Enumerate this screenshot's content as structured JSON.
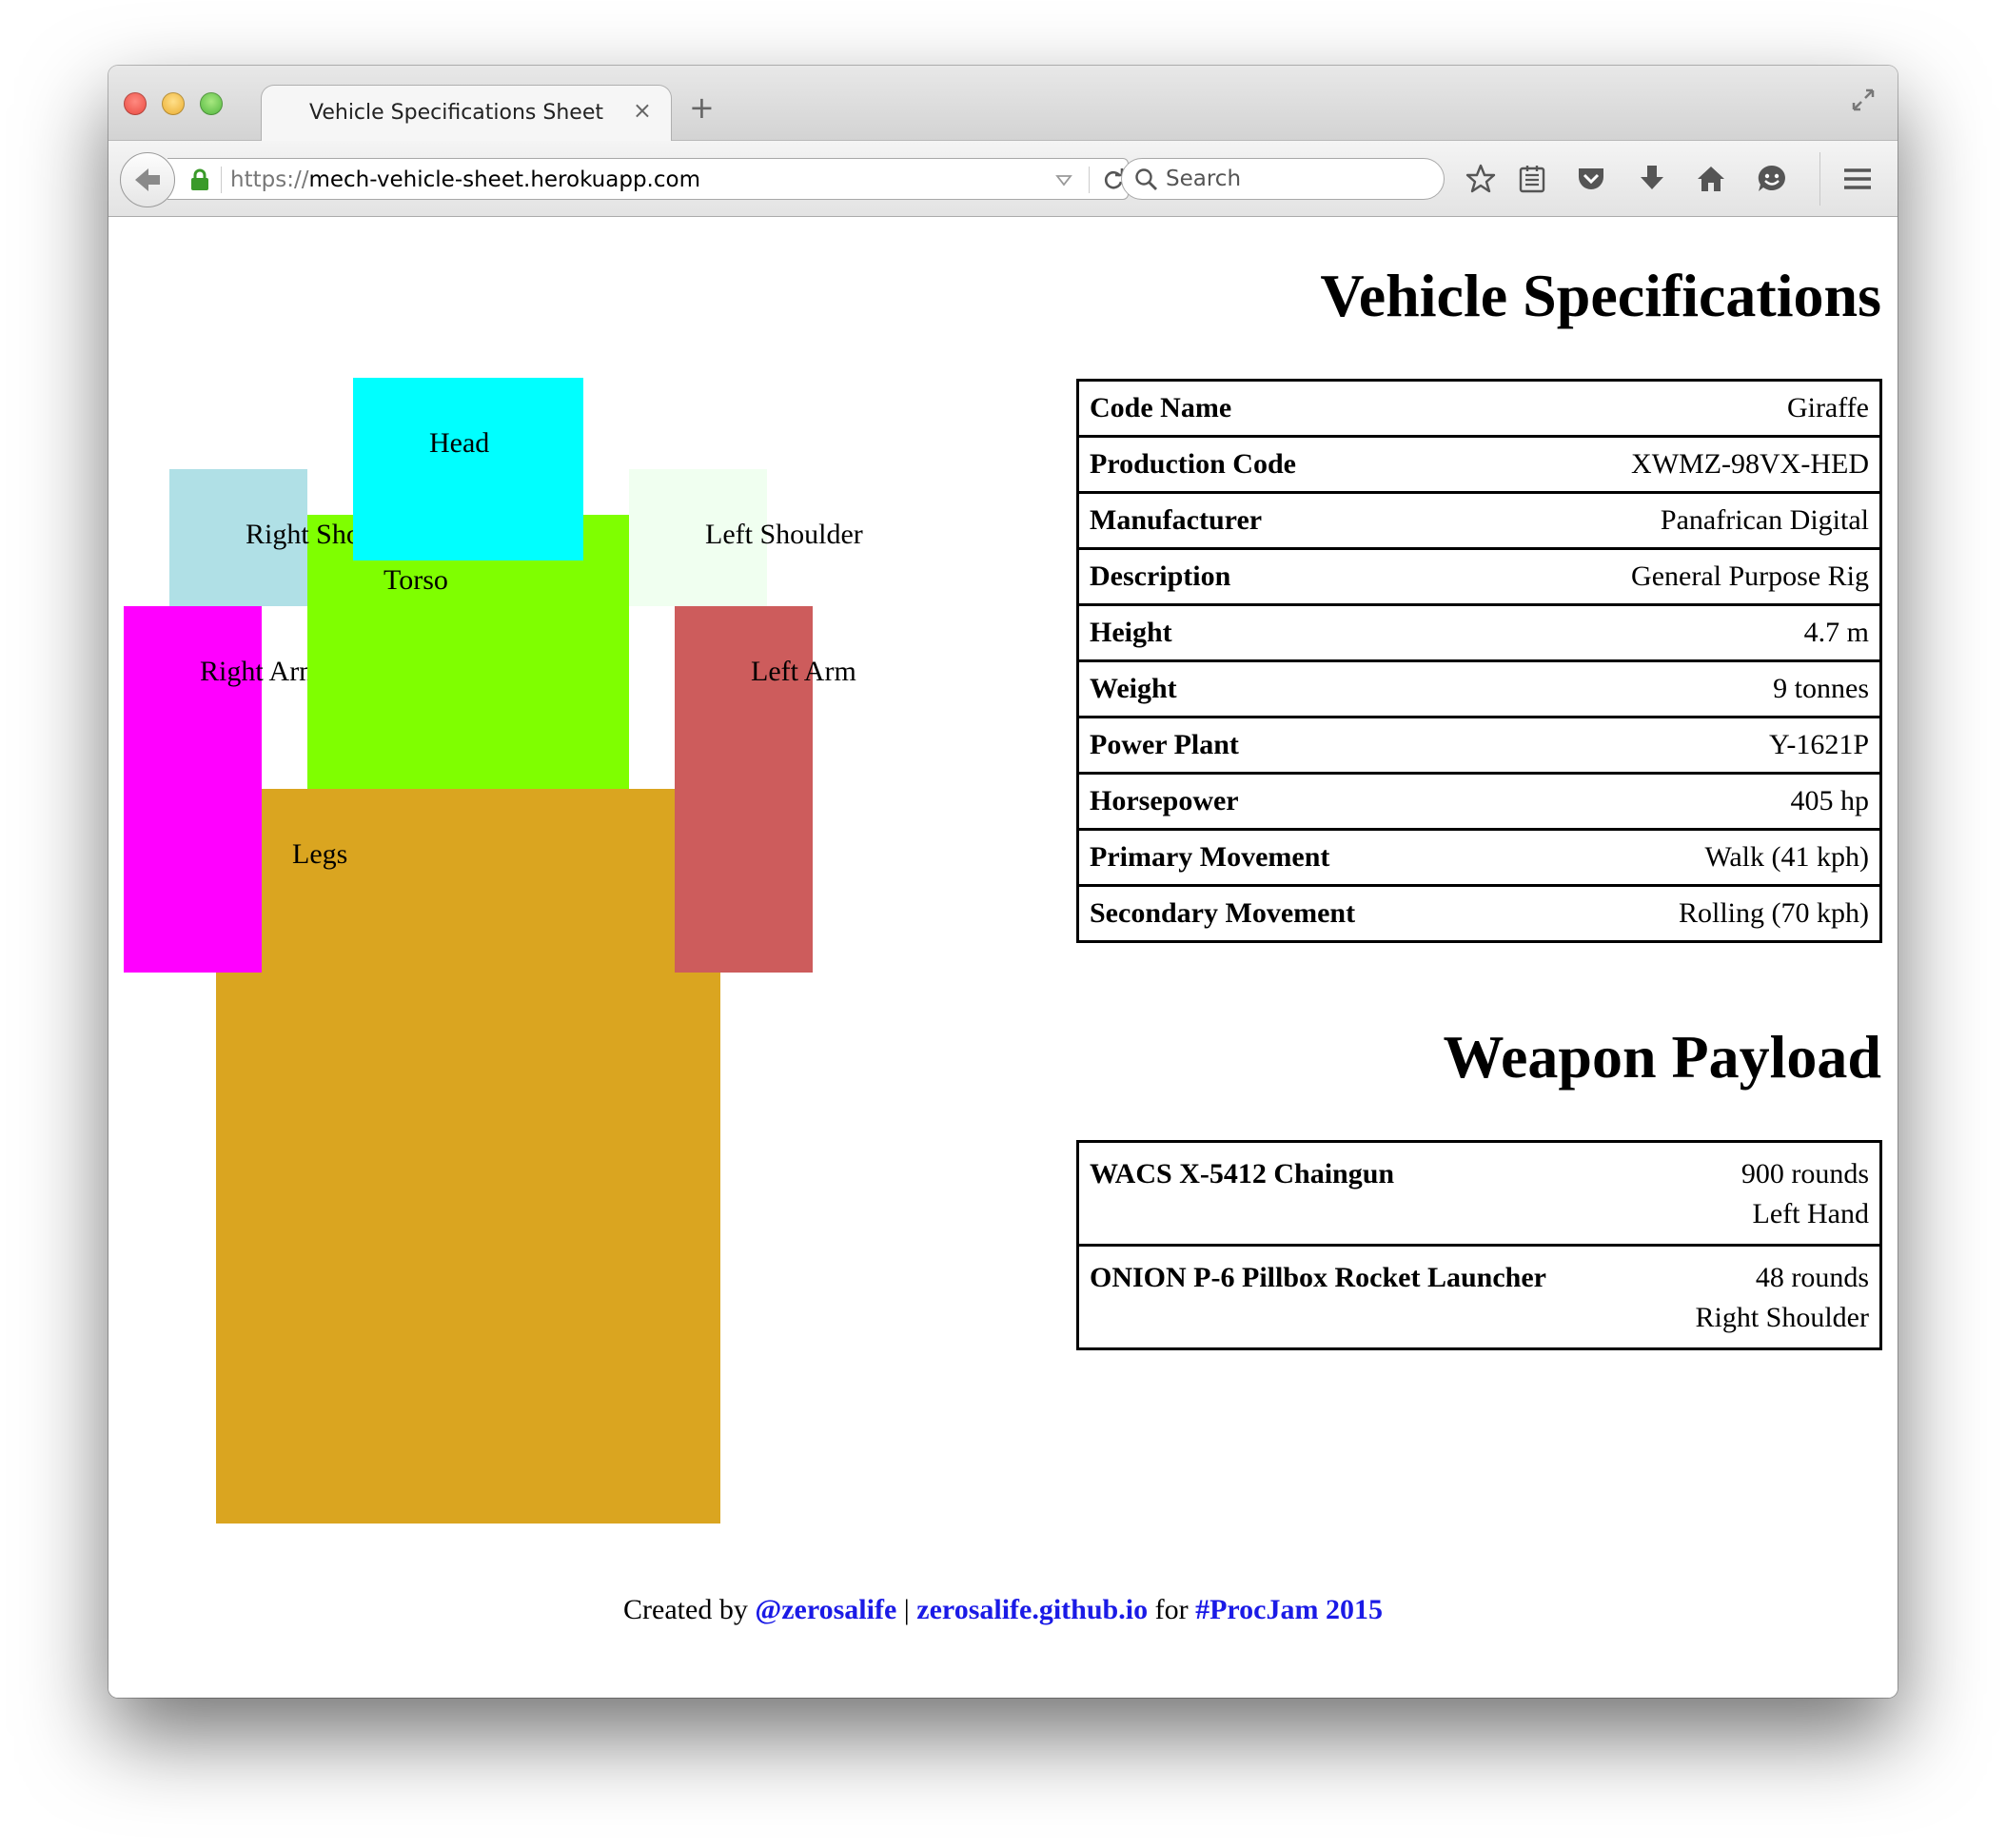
{
  "browser": {
    "tab_title": "Vehicle Specifications Sheet",
    "tab_close": "×",
    "new_tab": "+",
    "url_scheme": "https://",
    "url_host": "mech-vehicle-sheet.herokuapp.com",
    "search_placeholder": "Search",
    "toolbar_icons": [
      "bookmark-star-icon",
      "reading-list-icon",
      "pocket-icon",
      "download-icon",
      "home-icon",
      "hello-chat-icon",
      "menu-icon"
    ]
  },
  "mech": {
    "parts": [
      {
        "id": "legs",
        "label": "Legs",
        "color": "#DAA520"
      },
      {
        "id": "right-arm",
        "label": "Right Arm",
        "color": "#FF00FF"
      },
      {
        "id": "left-arm",
        "label": "Left Arm",
        "color": "#CD5C5C"
      },
      {
        "id": "torso",
        "label": "Torso",
        "color": "#7FFF00"
      },
      {
        "id": "right-shoulder",
        "label": "Right Shoulder",
        "color": "#B0E0E6"
      },
      {
        "id": "left-shoulder",
        "label": "Left Shoulder",
        "color": "#F0FFF0"
      },
      {
        "id": "head",
        "label": "Head",
        "color": "#00FFFF"
      }
    ]
  },
  "specs": {
    "title": "Vehicle Specifications",
    "rows": [
      {
        "label": "Code Name",
        "value": "Giraffe"
      },
      {
        "label": "Production Code",
        "value": "XWMZ-98VX-HED"
      },
      {
        "label": "Manufacturer",
        "value": "Panafrican Digital"
      },
      {
        "label": "Description",
        "value": "General Purpose Rig"
      },
      {
        "label": "Height",
        "value": "4.7 m"
      },
      {
        "label": "Weight",
        "value": "9 tonnes"
      },
      {
        "label": "Power Plant",
        "value": "Y-1621P"
      },
      {
        "label": "Horsepower",
        "value": "405 hp"
      },
      {
        "label": "Primary Movement",
        "value": "Walk (41 kph)"
      },
      {
        "label": "Secondary Movement",
        "value": "Rolling (70 kph)"
      }
    ]
  },
  "weapons": {
    "title": "Weapon Payload",
    "items": [
      {
        "name": "WACS X-5412 Chaingun",
        "ammo": "900 rounds",
        "mount": "Left Hand"
      },
      {
        "name": "ONION P-6 Pillbox Rocket Launcher",
        "ammo": "48 rounds",
        "mount": "Right Shoulder"
      }
    ]
  },
  "footer": {
    "prefix": "Created by",
    "author": "@zerosalife",
    "separator": "|",
    "site": "zerosalife.github.io",
    "for_text": "for",
    "event": "#ProcJam 2015"
  }
}
